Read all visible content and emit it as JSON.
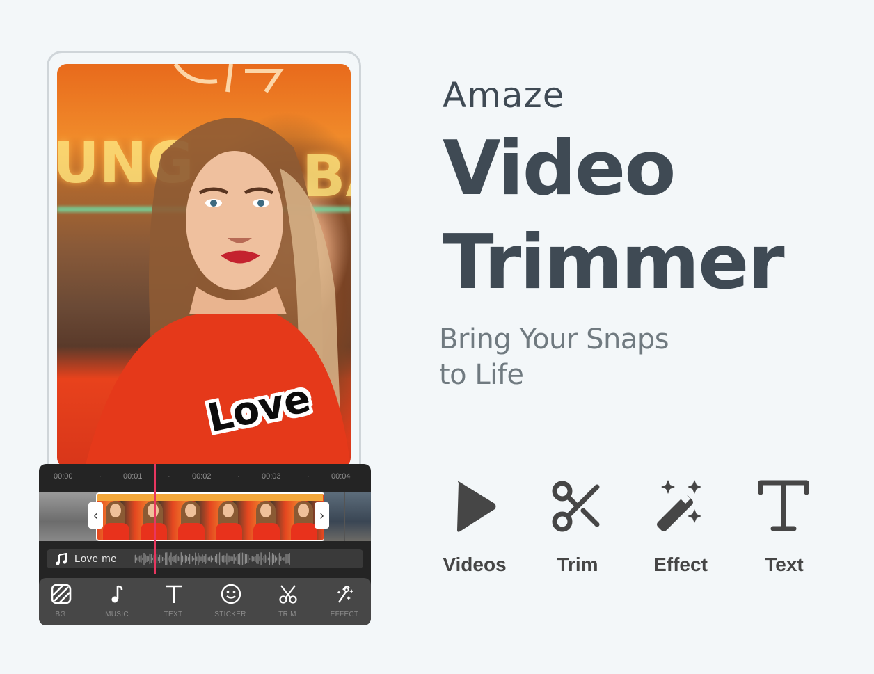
{
  "headline": {
    "brand": "Amaze",
    "line1": "Video",
    "line2": "Trimmer",
    "tagline_line1": "Bring Your Snaps",
    "tagline_line2": "to Life"
  },
  "preview": {
    "sticker_text": "Love",
    "background_sign_left": "UNG",
    "background_sign_right": "BA"
  },
  "timeline": {
    "ticks": [
      "00:00",
      "00:01",
      "00:02",
      "00:03",
      "00:04"
    ],
    "playhead_position": "00:01",
    "trim_start_handle": "‹",
    "trim_end_handle": "›",
    "selected_clip_frames": 6
  },
  "audio_track": {
    "icon": "music-note-icon",
    "label": "Love me"
  },
  "toolbar": {
    "items": [
      {
        "icon": "background-icon",
        "label": "BG"
      },
      {
        "icon": "music-icon",
        "label": "MUSIC"
      },
      {
        "icon": "text-icon",
        "label": "TEXT"
      },
      {
        "icon": "sticker-icon",
        "label": "STICKER"
      },
      {
        "icon": "scissors-icon",
        "label": "TRIM"
      },
      {
        "icon": "magic-wand-icon",
        "label": "EFFECT"
      }
    ]
  },
  "features": [
    {
      "icon": "play-icon",
      "label": "Videos"
    },
    {
      "icon": "scissors-icon",
      "label": "Trim"
    },
    {
      "icon": "magic-wand-icon",
      "label": "Effect"
    },
    {
      "icon": "text-icon",
      "label": "Text"
    }
  ],
  "colors": {
    "background": "#f3f7f9",
    "headline": "#3f4a54",
    "tagline": "#707a80",
    "editor_bg": "#242424",
    "toolbar_bg": "#474747",
    "playhead": "#e8365f",
    "feature_icon": "#464646"
  }
}
